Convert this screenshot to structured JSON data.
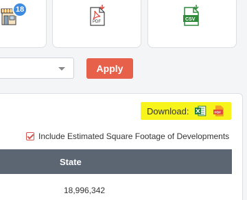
{
  "tiles": {
    "store": {
      "badge": "18",
      "icon": "store-icon"
    },
    "pdf": {
      "icon": "pdf-file-icon",
      "text": "PDF"
    },
    "csv": {
      "icon": "csv-file-icon",
      "text": "CSV"
    }
  },
  "filter": {
    "select_value": "",
    "apply_label": "Apply"
  },
  "panel": {
    "download_label": "Download:",
    "include_label": "Include Estimated Square Footage of Developments",
    "include_checked": true
  },
  "table": {
    "columns": [
      "State"
    ],
    "rows": [
      [
        "18,996,342"
      ]
    ]
  },
  "colors": {
    "apply": "#e7604a",
    "badge": "#3d8be0",
    "highlight": "#f7f41c",
    "header": "#5c6673"
  }
}
